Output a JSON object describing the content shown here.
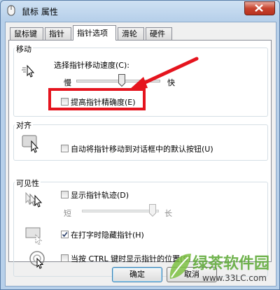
{
  "window": {
    "title": "鼠标 属性",
    "accent": "#b7d0ea",
    "close_color": "#c7432e"
  },
  "tabs": [
    {
      "label": "鼠标键"
    },
    {
      "label": "指针"
    },
    {
      "label": "指针选项",
      "active": true
    },
    {
      "label": "滑轮"
    },
    {
      "label": "硬件"
    }
  ],
  "motion": {
    "title": "移动",
    "speed_label": "选择指针移动速度(C):",
    "slow": "慢",
    "fast": "快",
    "precision_label": "提高指针精确度(E)",
    "precision_checked": false
  },
  "snap": {
    "title": "对齐",
    "label": "自动将指针移动到对话框中的默认按钮(U)",
    "checked": false
  },
  "visibility": {
    "title": "可见性",
    "trails_label": "显示指针轨迹(D)",
    "trails_checked": false,
    "short": "短",
    "long": "长",
    "hide_label": "在打字时隐藏指针(H)",
    "hide_checked": true,
    "ctrl_label": "当按 CTRL 键时显示指针的位置(S)",
    "ctrl_checked": false
  },
  "buttons": {
    "ok": "确定",
    "cancel": "取消"
  },
  "annotation_color": "#e5141e",
  "watermark": {
    "text": "绿茶软件园",
    "url": "www.33LC.com"
  }
}
